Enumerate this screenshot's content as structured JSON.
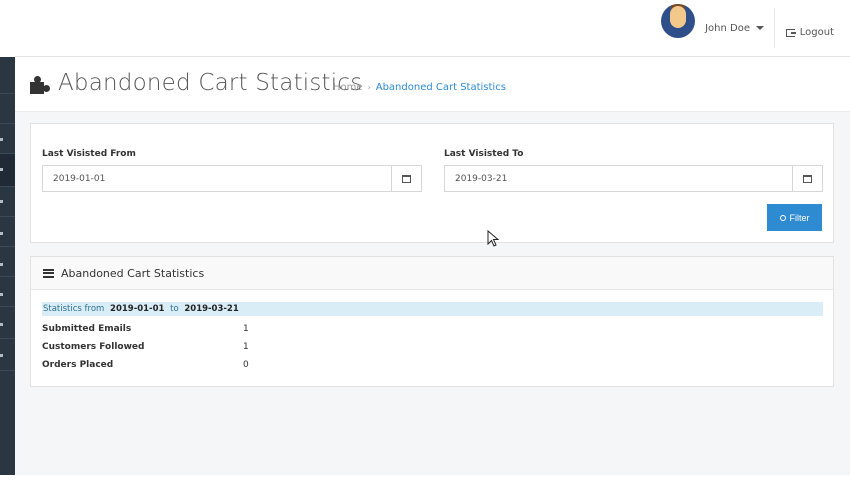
{
  "header": {
    "user_name": "John Doe",
    "logout_label": "Logout"
  },
  "title": {
    "page_title": "Abandoned Cart Statistics",
    "breadcrumb_home": "Home",
    "breadcrumb_current": "Abandoned Cart Statistics"
  },
  "filter": {
    "from_label": "Last Visisted From",
    "from_value": "2019-01-01",
    "to_label": "Last Visisted To",
    "to_value": "2019-03-21",
    "filter_button": "Filter"
  },
  "stats": {
    "heading": "Abandoned Cart Statistics",
    "range_prefix": "Statistics from",
    "range_from": "2019-01-01",
    "range_mid": "to",
    "range_to": "2019-03-21",
    "rows": [
      {
        "label": "Submitted Emails",
        "value": "1"
      },
      {
        "label": "Customers Followed",
        "value": "1"
      },
      {
        "label": "Orders Placed",
        "value": "0"
      }
    ]
  },
  "colors": {
    "accent": "#2e8bd1",
    "sidebar": "#2b3643",
    "info_bg": "#d9edf7"
  },
  "icons": [
    "puzzle-icon",
    "calendar-icon",
    "search-icon",
    "list-icon",
    "logout-icon",
    "caret-down-icon"
  ]
}
